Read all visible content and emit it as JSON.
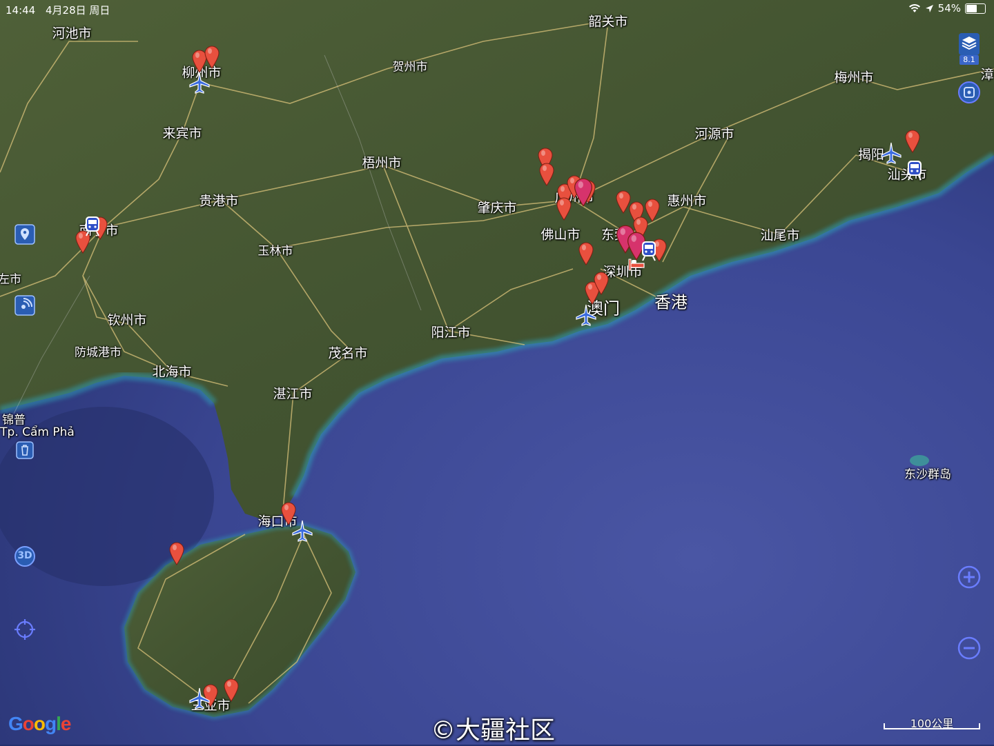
{
  "status_bar": {
    "time": "14:44",
    "date": "4月28日 周日",
    "battery": "54%",
    "battery_level": 0.54
  },
  "map": {
    "labels": [
      {
        "id": "hechi",
        "text": "河池市"
      },
      {
        "id": "liuzhou",
        "text": "柳州市"
      },
      {
        "id": "hezhou",
        "text": "贺州市"
      },
      {
        "id": "shaoguan",
        "text": "韶关市"
      },
      {
        "id": "meizhou",
        "text": "梅州市"
      },
      {
        "id": "zhang",
        "text": "漳"
      },
      {
        "id": "laibin",
        "text": "来宾市"
      },
      {
        "id": "heyuan",
        "text": "河源市"
      },
      {
        "id": "jieyang",
        "text": "揭阳"
      },
      {
        "id": "shantou",
        "text": "汕头市"
      },
      {
        "id": "wuzhou",
        "text": "梧州市"
      },
      {
        "id": "guigang",
        "text": "贵港市"
      },
      {
        "id": "zhaoqing",
        "text": "肇庆市"
      },
      {
        "id": "guangzhou",
        "text": "广州市"
      },
      {
        "id": "huizhou",
        "text": "惠州市"
      },
      {
        "id": "nanning",
        "text": "南宁市"
      },
      {
        "id": "foshan",
        "text": "佛山市"
      },
      {
        "id": "dongguan",
        "text": "东莞"
      },
      {
        "id": "shanwei",
        "text": "汕尾市"
      },
      {
        "id": "yulin",
        "text": "玉林市"
      },
      {
        "id": "shenzhen",
        "text": "深圳市"
      },
      {
        "id": "chongzuo",
        "text": "左市"
      },
      {
        "id": "macau",
        "text": "澳门"
      },
      {
        "id": "hongkong",
        "text": "香港"
      },
      {
        "id": "qinzhou",
        "text": "钦州市"
      },
      {
        "id": "yangjiang",
        "text": "阳江市"
      },
      {
        "id": "fangchenggang",
        "text": "防城港市"
      },
      {
        "id": "maoming",
        "text": "茂名市"
      },
      {
        "id": "beihai",
        "text": "北海市"
      },
      {
        "id": "zhanjiang",
        "text": "湛江市"
      },
      {
        "id": "campha_cn",
        "text": "锦普"
      },
      {
        "id": "campha_vi",
        "text": "Tp. Cẩm Phả"
      },
      {
        "id": "dongsha",
        "text": "东沙群岛"
      },
      {
        "id": "haikou",
        "text": "海口市"
      },
      {
        "id": "sanya",
        "text": "三亚市"
      }
    ],
    "scale_label": "100公里",
    "attribution_logo": "Google",
    "watermark": "©大疆社区"
  },
  "controls": {
    "layers_version": "8.1",
    "left_buttons": [
      "location-pin-icon",
      "wifi-signal-icon",
      "trash-icon",
      "3d-toggle",
      "crosshair-icon"
    ],
    "right_buttons": [
      "layers-icon",
      "compass-icon",
      "zoom-in-icon",
      "zoom-out-icon"
    ],
    "three_d_label": "3D"
  },
  "colors": {
    "pin_red": "#e8503e",
    "pin_magenta": "#d6336c",
    "control_blue": "#4f6bff",
    "plane_blue": "#3a6be0"
  }
}
